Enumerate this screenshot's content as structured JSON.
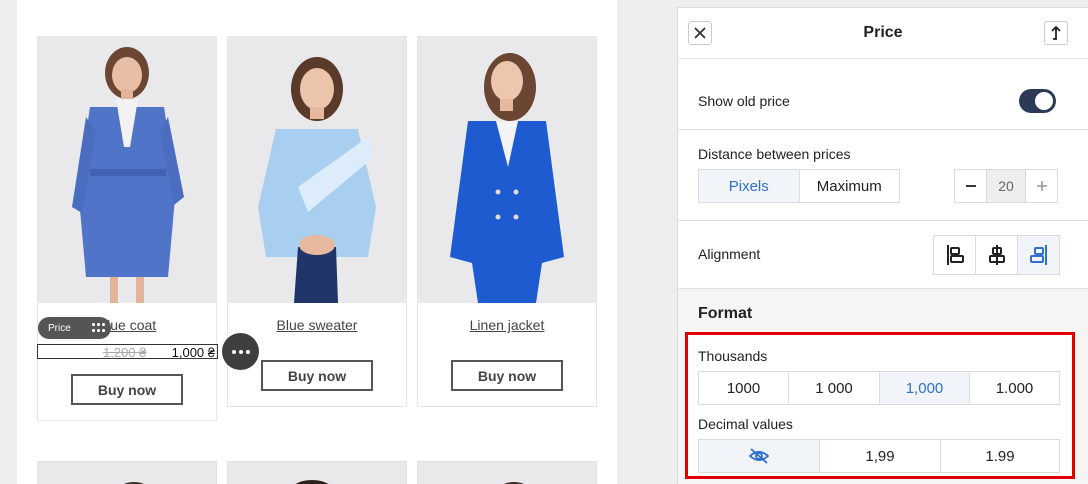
{
  "products": [
    {
      "name": "Blue coat",
      "buy_label": "Buy now"
    },
    {
      "name": "Blue sweater",
      "buy_label": "Buy now"
    },
    {
      "name": "Linen jacket",
      "buy_label": "Buy now"
    }
  ],
  "price_element": {
    "tag_label": "Price",
    "old_price": "1,200 ₴",
    "new_price": "1,000 ₴"
  },
  "panel": {
    "title": "Price",
    "show_old_price": {
      "label": "Show old price",
      "enabled": true
    },
    "distance": {
      "label": "Distance between prices",
      "options": [
        "Pixels",
        "Maximum"
      ],
      "selected": "Pixels",
      "value": "20"
    },
    "alignment": {
      "label": "Alignment",
      "options": [
        "align-left-icon",
        "align-center-icon",
        "align-right-icon"
      ],
      "selected": "align-right-icon"
    },
    "format": {
      "title": "Format",
      "thousands": {
        "label": "Thousands",
        "options": [
          "1000",
          "1 000",
          "1,000",
          "1.000"
        ],
        "selected": "1,000"
      },
      "decimal": {
        "label": "Decimal values",
        "options": [
          "hidden-eye-icon",
          "1,99",
          "1.99"
        ],
        "selected": "hidden-eye-icon"
      }
    }
  },
  "colors": {
    "accent": "#2f6fd0",
    "toggle": "#2b3b57",
    "highlight": "#e00000",
    "coat": "#4f74c8",
    "sweater": "#a9cff0",
    "jacket": "#1e5bd0"
  }
}
